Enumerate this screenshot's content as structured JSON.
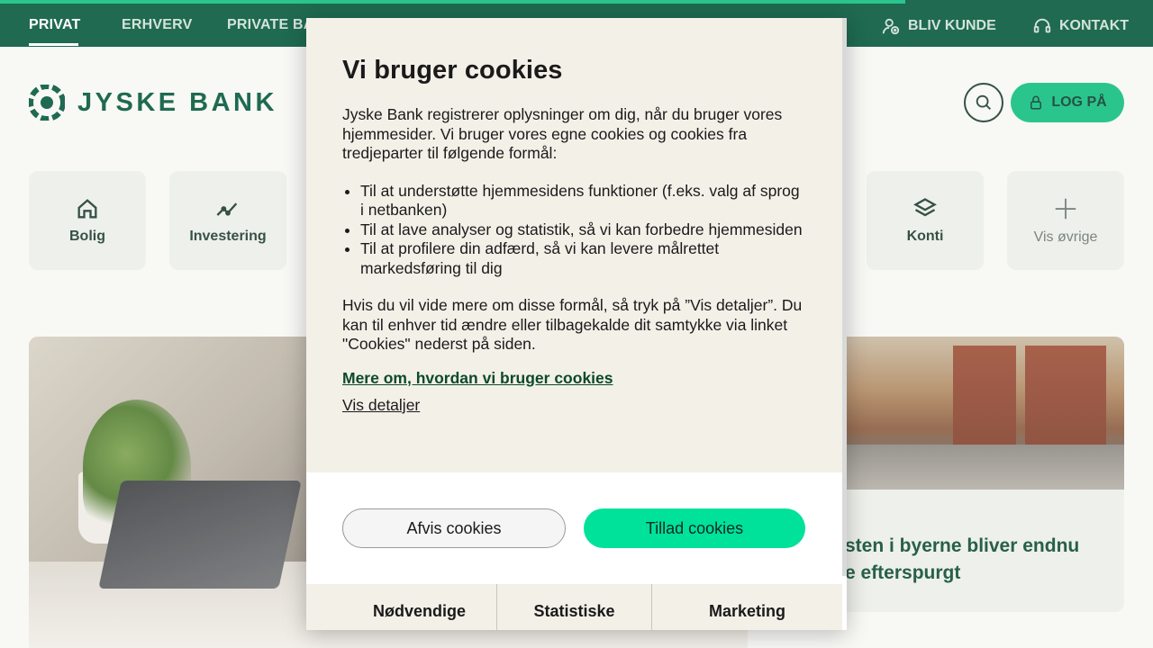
{
  "topnav": {
    "items": [
      "PRIVAT",
      "ERHVERV",
      "PRIVATE BA"
    ],
    "right": [
      "BLIV KUNDE",
      "KONTAKT"
    ]
  },
  "header": {
    "logo_text": "JYSKE BANK",
    "login_label": "LOG PÅ"
  },
  "tiles": [
    "Bolig",
    "Investering",
    "Konti",
    "Vis øvrige"
  ],
  "card": {
    "title_line1": "sten i byerne bliver endnu",
    "title_line2": "e efterspurgt"
  },
  "dialog": {
    "title": "Vi bruger cookies",
    "intro": "Jyske Bank registrerer oplysninger om dig, når du bruger vores hjemmesider. Vi bruger vores egne cookies og cookies fra tredjeparter til følgende formål:",
    "bullets": [
      "Til at understøtte hjemmesidens funktioner (f.eks. valg af sprog i netbanken)",
      "Til at lave analyser og statistik, så vi kan forbedre hjemmesiden",
      "Til at profilere din adfærd, så vi kan levere målrettet markedsføring til dig"
    ],
    "outro": "Hvis du vil vide mere om disse formål, så tryk på ”Vis detaljer”. Du kan til enhver tid ændre eller tilbagekalde dit samtykke via linket \"Cookies\" nederst på siden.",
    "more_link": "Mere om, hvordan vi bruger cookies",
    "details_link": "Vis detaljer",
    "decline_label": "Afvis cookies",
    "accept_label": "Tillad cookies",
    "tabs": [
      "Nødvendige",
      "Statistiske",
      "Marketing"
    ]
  },
  "colors": {
    "nav_green": "#00563a",
    "accent_green": "#00e19a",
    "login_green": "#0dbd7e",
    "dialog_bg": "#f3f0e8"
  }
}
